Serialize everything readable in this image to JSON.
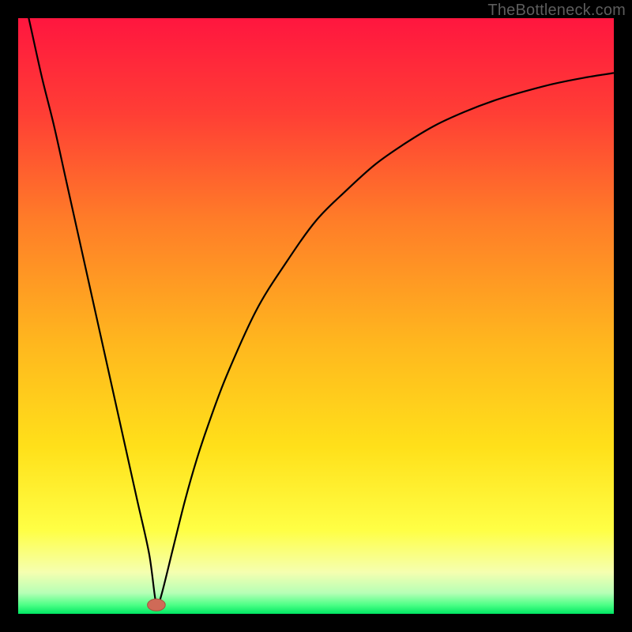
{
  "watermark": "TheBottleneck.com",
  "colors": {
    "frame": "#000000",
    "curve": "#000000",
    "marker_fill": "#cf6a57",
    "marker_stroke": "#a8503f",
    "gradient_stops": [
      {
        "offset": 0,
        "color": "#ff163f"
      },
      {
        "offset": 0.16,
        "color": "#ff3e35"
      },
      {
        "offset": 0.34,
        "color": "#ff7d28"
      },
      {
        "offset": 0.55,
        "color": "#ffb81e"
      },
      {
        "offset": 0.72,
        "color": "#ffe01a"
      },
      {
        "offset": 0.86,
        "color": "#ffff45"
      },
      {
        "offset": 0.93,
        "color": "#f5ffb0"
      },
      {
        "offset": 0.965,
        "color": "#b6ffb6"
      },
      {
        "offset": 0.985,
        "color": "#4dff86"
      },
      {
        "offset": 1.0,
        "color": "#00e763"
      }
    ]
  },
  "chart_data": {
    "type": "line",
    "title": "",
    "xlabel": "",
    "ylabel": "",
    "xlim": [
      0,
      100
    ],
    "ylim": [
      0,
      100
    ],
    "series": [
      {
        "name": "bottleneck-curve",
        "x": [
          0,
          2,
          4,
          6,
          8,
          10,
          12,
          14,
          16,
          18,
          20,
          22,
          23.2,
          24,
          26,
          28,
          30,
          32,
          35,
          40,
          45,
          50,
          55,
          60,
          65,
          70,
          75,
          80,
          85,
          90,
          95,
          100
        ],
        "y": [
          108,
          99,
          90,
          82,
          73,
          64,
          55,
          46,
          37,
          28,
          19,
          10,
          1.5,
          3,
          11,
          19,
          26,
          32,
          40,
          51,
          59,
          66,
          71,
          75.5,
          79,
          82,
          84.3,
          86.2,
          87.7,
          89,
          90,
          90.8
        ]
      }
    ],
    "marker": {
      "x": 23.2,
      "y": 1.5,
      "rx": 1.5,
      "ry": 1.0
    },
    "notes": "y read as percent of plot height from bottom; values estimated from pixels."
  }
}
